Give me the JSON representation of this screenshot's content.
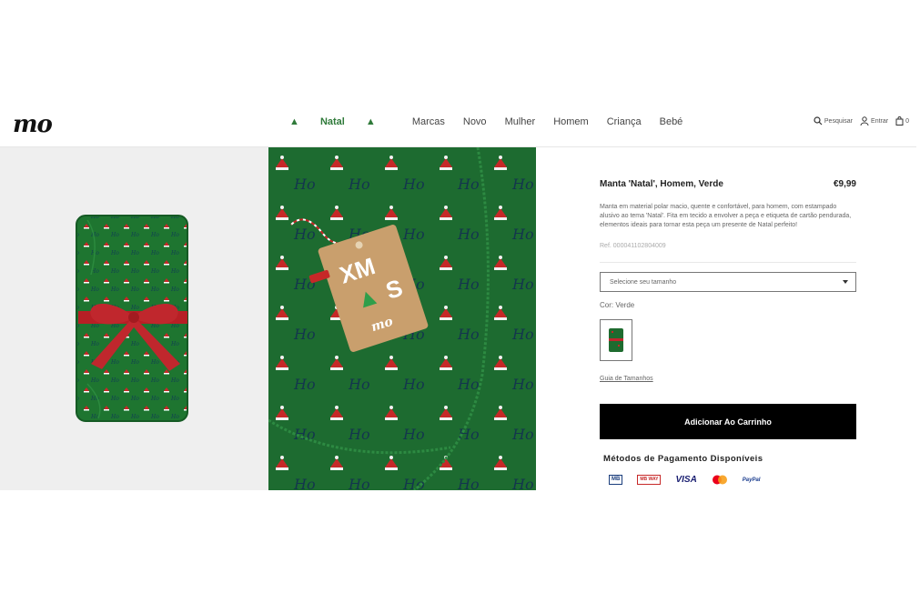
{
  "header": {
    "logo": "mo",
    "nav": [
      "Natal",
      "Marcas",
      "Novo",
      "Mulher",
      "Homem",
      "Criança",
      "Bebé"
    ],
    "search_label": "Pesquisar",
    "login_label": "Entrar",
    "cart_count": "0"
  },
  "product": {
    "title": "Manta 'Natal', Homem, Verde",
    "price": "€9,99",
    "description": "Manta em material polar macio, quente e confortável, para homem, com estampado alusivo ao tema 'Natal'. Fita em tecido a envolver a peça e etiqueta de cartão pendurada, elementos ideais para tornar esta peça um presente de Natal perfeito!",
    "ref": "Ref. 000041102804009",
    "size_placeholder": "Selecione seu tamanho",
    "color_label": "Cor: Verde",
    "size_guide": "Guia de Tamanhos",
    "add_to_cart": "Adicionar Ao Carrinho",
    "tag_text_top": "XM",
    "tag_text_bottom": "S",
    "tag_brand": "mo"
  },
  "payment": {
    "title": "Métodos de Pagamento Disponíveis",
    "methods": [
      "MB",
      "MB WAY",
      "VISA",
      "Mastercard",
      "PayPal"
    ]
  },
  "colors": {
    "accent_green": "#2f7a3a",
    "blanket_green": "#1d6b30",
    "button_black": "#000000",
    "ribbon_red": "#c0272d"
  }
}
